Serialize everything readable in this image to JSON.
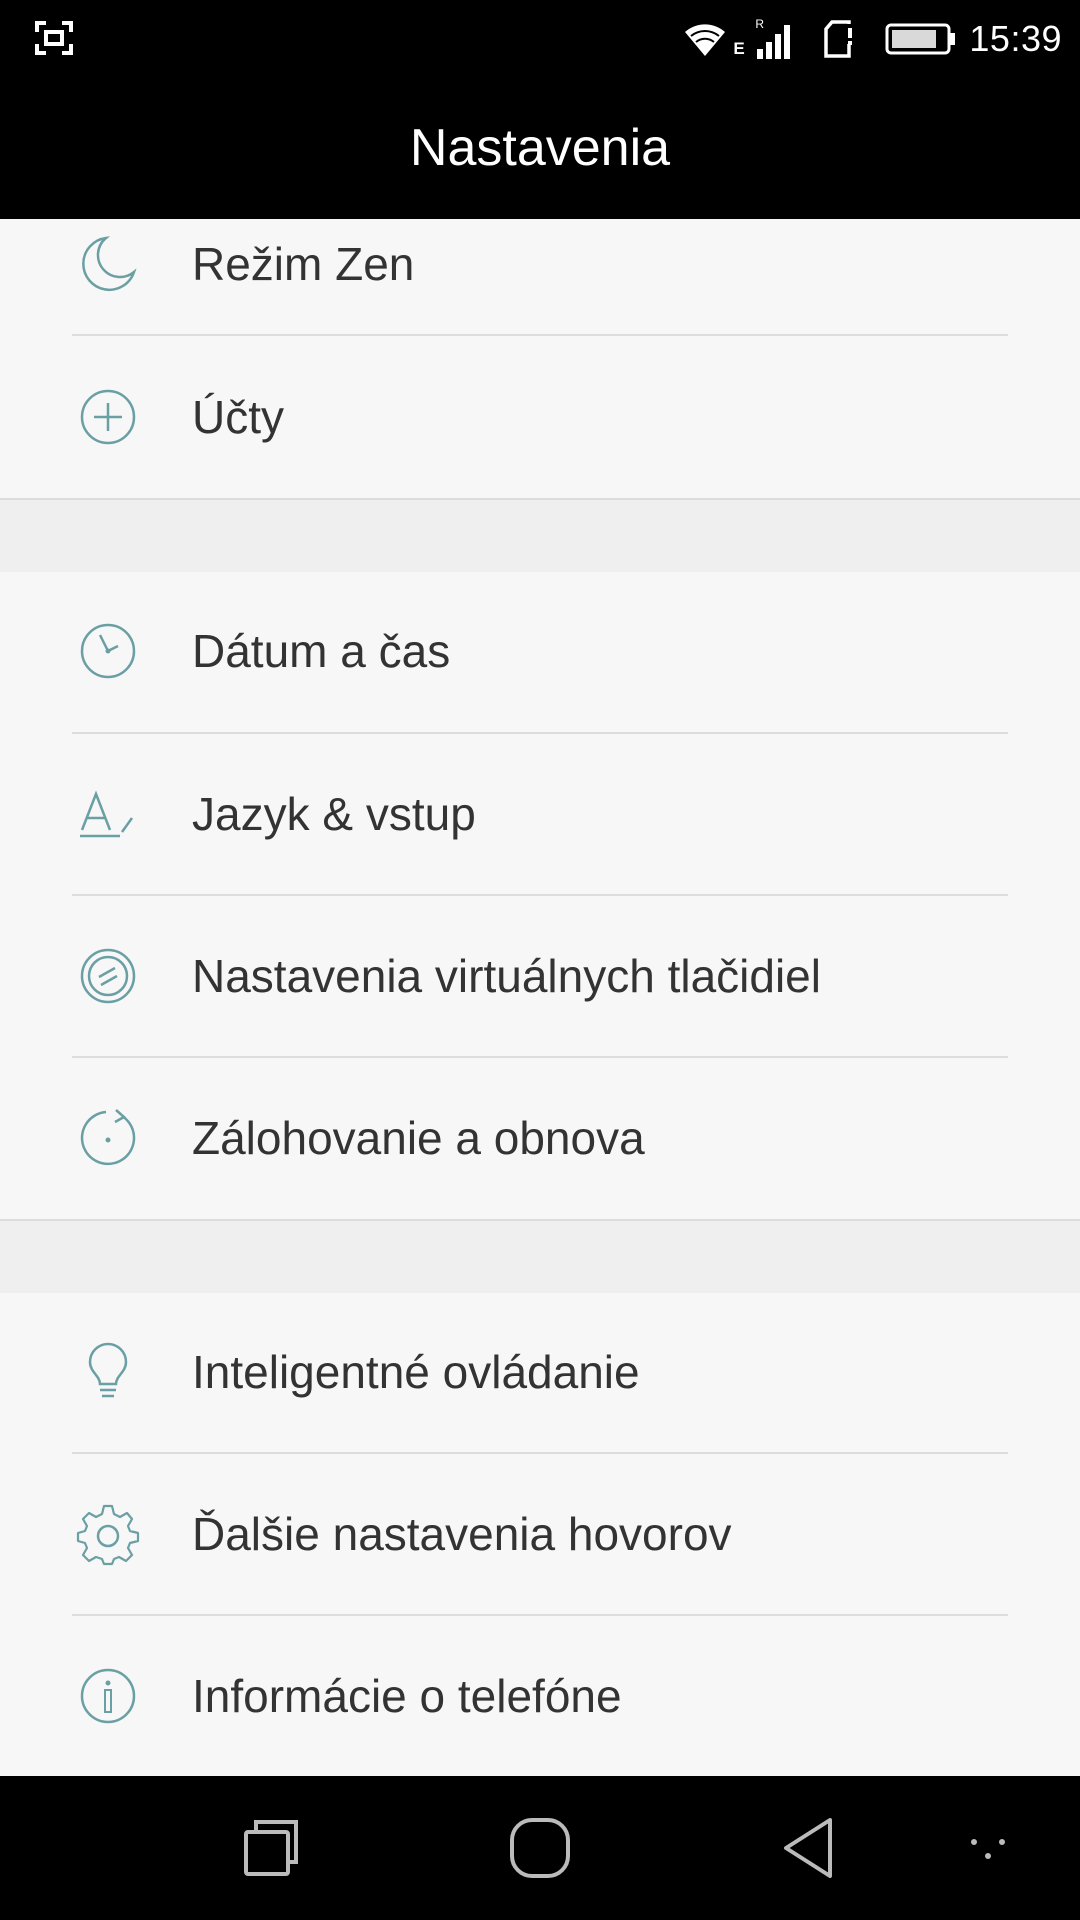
{
  "status_bar": {
    "time": "15:39",
    "network_type": "E",
    "network_sub": "R",
    "icons": [
      "screenshot-icon",
      "wifi-icon",
      "signal-icon",
      "sim-icon",
      "battery-icon"
    ]
  },
  "app_bar": {
    "title": "Nastavenia"
  },
  "settings": {
    "items": [
      {
        "label": "Režim Zen",
        "icon": "moon-icon"
      },
      {
        "label": "Účty",
        "icon": "plus-circle-icon"
      },
      {
        "label": "Dátum a čas",
        "icon": "clock-icon"
      },
      {
        "label": "Jazyk & vstup",
        "icon": "language-icon"
      },
      {
        "label": "Nastavenia virtuálnych tlačidiel",
        "icon": "virtual-buttons-icon"
      },
      {
        "label": "Zálohovanie a obnova",
        "icon": "backup-icon"
      },
      {
        "label": "Inteligentné ovládanie",
        "icon": "lightbulb-icon"
      },
      {
        "label": "Ďalšie nastavenia hovorov",
        "icon": "gear-icon"
      },
      {
        "label": "Informácie o telefóne",
        "icon": "info-icon"
      }
    ]
  },
  "nav_bar": {
    "icons": [
      "recents-icon",
      "home-icon",
      "back-icon",
      "menu-dots-icon"
    ]
  },
  "colors": {
    "icon_accent": "#6a9fa4",
    "background": "#f7f7f7",
    "bars": "#000000"
  }
}
